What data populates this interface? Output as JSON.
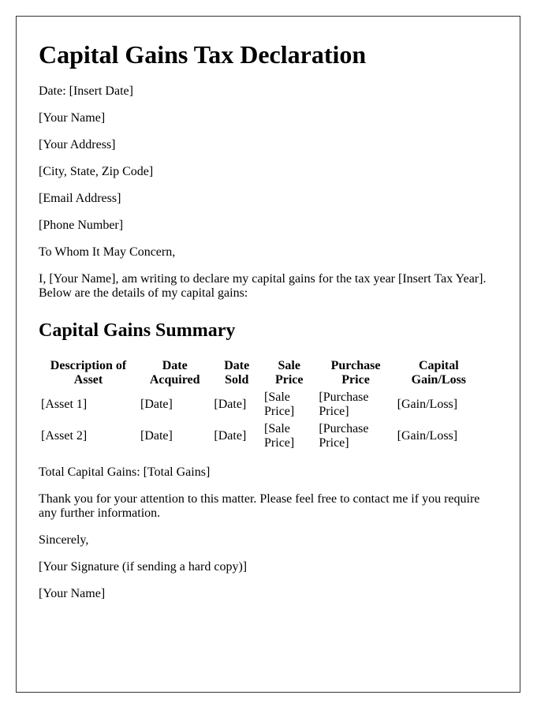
{
  "document": {
    "title": "Capital Gains Tax Declaration",
    "date_line": "Date: [Insert Date]",
    "sender": {
      "name": "[Your Name]",
      "address": "[Your Address]",
      "city_state_zip": "[City, State, Zip Code]",
      "email": "[Email Address]",
      "phone": "[Phone Number]"
    },
    "salutation": "To Whom It May Concern,",
    "intro_paragraph": "I, [Your Name], am writing to declare my capital gains for the tax year [Insert Tax Year]. Below are the details of my capital gains:",
    "summary_heading": "Capital Gains Summary",
    "table": {
      "headers": [
        "Description of Asset",
        "Date Acquired",
        "Date Sold",
        "Sale Price",
        "Purchase Price",
        "Capital Gain/Loss"
      ],
      "rows": [
        [
          "[Asset 1]",
          "[Date]",
          "[Date]",
          "[Sale Price]",
          "[Purchase Price]",
          "[Gain/Loss]"
        ],
        [
          "[Asset 2]",
          "[Date]",
          "[Date]",
          "[Sale Price]",
          "[Purchase Price]",
          "[Gain/Loss]"
        ]
      ]
    },
    "total_line": "Total Capital Gains: [Total Gains]",
    "closing_paragraph": "Thank you for your attention to this matter. Please feel free to contact me if you require any further information.",
    "sign_off": "Sincerely,",
    "signature": "[Your Signature (if sending a hard copy)]",
    "signer_name": "[Your Name]"
  }
}
